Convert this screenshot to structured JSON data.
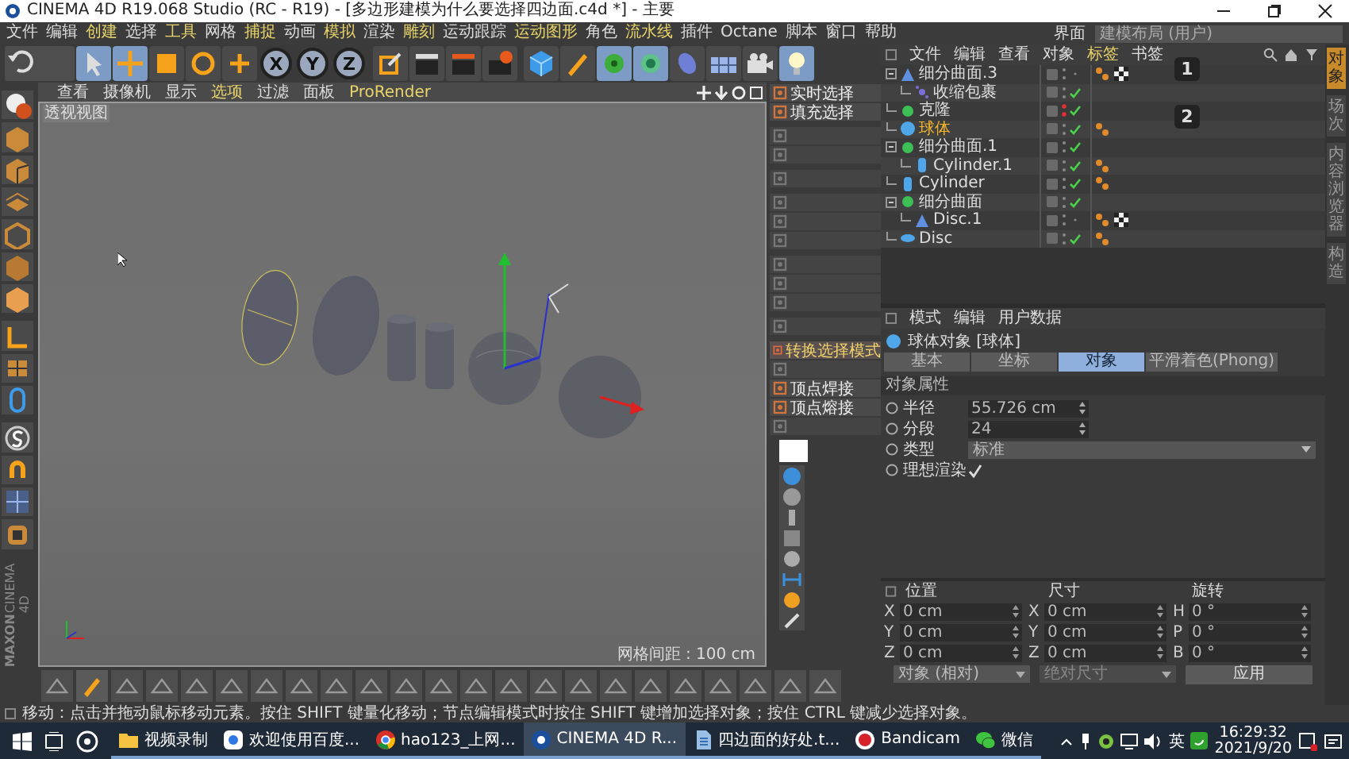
{
  "window": {
    "title": "CINEMA 4D R19.068 Studio (RC - R19) - [多边形建模为什么要选择四边面.c4d *] - 主要"
  },
  "menu": [
    "文件",
    "编辑",
    "创建",
    "选择",
    "工具",
    "网格",
    "捕捉",
    "动画",
    "模拟",
    "渲染",
    "雕刻",
    "运动跟踪",
    "运动图形",
    "角色",
    "流水线",
    "插件",
    "Octane",
    "脚本",
    "窗口",
    "帮助"
  ],
  "layout": {
    "label": "界面",
    "value": "建模布局 (用户)"
  },
  "toolbar": {
    "axis_buttons": [
      "X",
      "Y",
      "Z"
    ]
  },
  "viewport": {
    "menu": [
      "查看",
      "摄像机",
      "显示",
      "选项",
      "过滤",
      "面板",
      "ProRender"
    ],
    "label": "透视视图",
    "grid_spacing": "网格间距 : 100 cm"
  },
  "tool_palette": [
    {
      "label": "实时选择",
      "disabled": false,
      "selected": false
    },
    {
      "label": "填充选择",
      "disabled": false,
      "selected": false
    },
    {
      "disabled": true,
      "selected": false
    },
    {
      "disabled": true,
      "selected": false
    },
    {
      "disabled": true,
      "selected": false
    },
    {
      "disabled": true,
      "selected": false
    },
    {
      "disabled": true,
      "selected": false
    },
    {
      "disabled": true,
      "selected": false
    },
    {
      "disabled": true,
      "selected": false
    },
    {
      "disabled": true,
      "selected": false
    },
    {
      "disabled": true,
      "selected": false
    },
    {
      "disabled": true,
      "selected": false
    },
    {
      "label": "转换选择模式",
      "disabled": false,
      "selected": true
    },
    {
      "disabled": true,
      "selected": false
    },
    {
      "label": "顶点焊接",
      "disabled": false,
      "selected": false
    },
    {
      "label": "顶点熔接",
      "disabled": false,
      "selected": false
    },
    {
      "disabled": true,
      "selected": false
    }
  ],
  "logo": {
    "line1": "MAXON",
    "line2": "CINEMA 4D"
  },
  "object_manager": {
    "menu": [
      "文件",
      "编辑",
      "查看",
      "对象",
      "标签",
      "书签"
    ],
    "annotations": [
      "1",
      "2"
    ],
    "objects": [
      {
        "name": "细分曲面.3",
        "kind": "subdivision",
        "selected": false,
        "enabled": false,
        "hidden": false,
        "phong_tag": true,
        "texture_tag": true,
        "children": [
          {
            "name": "收缩包裹",
            "kind": "deformer",
            "selected": false,
            "enabled": true,
            "hidden": false,
            "phong_tag": false,
            "texture_tag": false
          }
        ]
      },
      {
        "name": "克隆",
        "kind": "generator",
        "selected": false,
        "enabled": true,
        "hidden": true,
        "phong_tag": false,
        "texture_tag": false
      },
      {
        "name": "球体",
        "kind": "sphere",
        "selected": true,
        "enabled": true,
        "hidden": false,
        "phong_tag": true,
        "texture_tag": false
      },
      {
        "name": "细分曲面.1",
        "kind": "generator",
        "selected": false,
        "enabled": true,
        "hidden": false,
        "phong_tag": false,
        "texture_tag": false,
        "children": [
          {
            "name": "Cylinder.1",
            "kind": "cylinder",
            "selected": false,
            "enabled": true,
            "hidden": false,
            "phong_tag": true,
            "texture_tag": false
          }
        ]
      },
      {
        "name": "Cylinder",
        "kind": "cylinder",
        "selected": false,
        "enabled": true,
        "hidden": false,
        "phong_tag": true,
        "texture_tag": false
      },
      {
        "name": "细分曲面",
        "kind": "generator",
        "selected": false,
        "enabled": true,
        "hidden": false,
        "phong_tag": false,
        "texture_tag": false,
        "children": [
          {
            "name": "Disc.1",
            "kind": "subdivision",
            "selected": false,
            "enabled": false,
            "hidden": false,
            "phong_tag": true,
            "texture_tag": true
          }
        ]
      },
      {
        "name": "Disc",
        "kind": "disc",
        "selected": false,
        "enabled": true,
        "hidden": false,
        "phong_tag": true,
        "texture_tag": false
      }
    ]
  },
  "side_tabs": [
    {
      "label": "对象",
      "selected": true
    },
    {
      "label": "场次",
      "selected": false
    },
    {
      "label": "内容浏览器",
      "selected": false
    },
    {
      "label": "构造",
      "selected": false
    }
  ],
  "attributes": {
    "menu": [
      "模式",
      "编辑",
      "用户数据"
    ],
    "object_title": "球体对象 [球体]",
    "tabs": [
      {
        "label": "基本",
        "selected": false
      },
      {
        "label": "坐标",
        "selected": false
      },
      {
        "label": "对象",
        "selected": true
      },
      {
        "label": "平滑着色(Phong)",
        "selected": false
      }
    ],
    "section": "对象属性",
    "fields": [
      {
        "kind": "number",
        "label": "半径",
        "value": "55.726 cm"
      },
      {
        "kind": "number",
        "label": "分段",
        "value": "24"
      },
      {
        "kind": "dropdown",
        "label": "类型",
        "value": "标准"
      },
      {
        "kind": "checkbox",
        "label": "理想渲染",
        "checked": true
      }
    ]
  },
  "coordinates": {
    "headers": [
      "位置",
      "尺寸",
      "旋转"
    ],
    "rows": [
      [
        {
          "axis": "X",
          "value": "0 cm"
        },
        {
          "axis": "X",
          "value": "0 cm"
        },
        {
          "axis": "H",
          "value": "0 °"
        }
      ],
      [
        {
          "axis": "Y",
          "value": "0 cm"
        },
        {
          "axis": "Y",
          "value": "0 cm"
        },
        {
          "axis": "P",
          "value": "0 °"
        }
      ],
      [
        {
          "axis": "Z",
          "value": "0 cm"
        },
        {
          "axis": "Z",
          "value": "0 cm"
        },
        {
          "axis": "B",
          "value": "0 °"
        }
      ]
    ],
    "dropdowns": [
      "对象 (相对)",
      "绝对尺寸"
    ],
    "apply": "应用"
  },
  "status_bar": "移动：点击并拖动鼠标移动元素。按住 SHIFT 键量化移动；节点编辑模式时按住 SHIFT 键增加选择对象；按住 CTRL 键减少选择对象。",
  "taskbar": {
    "apps": [
      {
        "label": "视频录制",
        "kind": "folder",
        "active": false
      },
      {
        "label": "欢迎使用百度...",
        "kind": "baidu",
        "active": false
      },
      {
        "label": "hao123_上网...",
        "kind": "chrome",
        "active": false
      },
      {
        "label": "CINEMA 4D R...",
        "kind": "c4d",
        "active": true
      },
      {
        "label": "四边面的好处.t...",
        "kind": "doc",
        "active": false
      },
      {
        "label": "Bandicam",
        "kind": "bandicam",
        "active": false
      },
      {
        "label": "微信",
        "kind": "wechat",
        "active": false
      }
    ],
    "ime": "英",
    "time": "16:29:32",
    "date": "2021/9/20"
  }
}
